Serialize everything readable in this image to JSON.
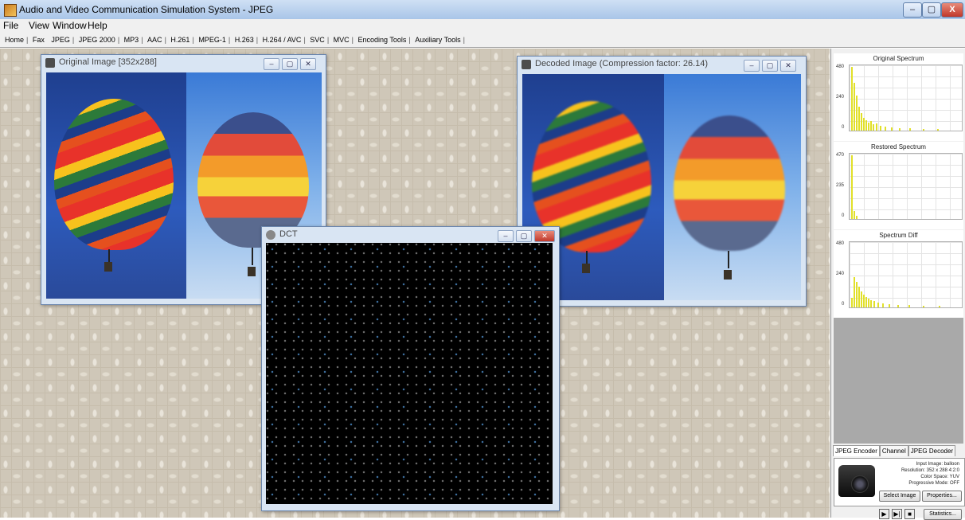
{
  "window": {
    "title": "Audio and Video Communication Simulation System - JPEG",
    "min": "–",
    "max": "▢",
    "close": "X"
  },
  "menu": {
    "file": "File",
    "view": "View",
    "window": "Window",
    "help": "Help"
  },
  "tabs": [
    "Home",
    "Fax",
    "JPEG",
    "JPEG 2000",
    "MP3",
    "AAC",
    "H.261",
    "MPEG-1",
    "H.263",
    "H.264 / AVC",
    "SVC",
    "MVC",
    "Encoding Tools",
    "Auxiliary Tools"
  ],
  "original_window": {
    "title": "Original Image [352x288]"
  },
  "decoded_window": {
    "title": "Decoded Image (Compression factor: 26.14)"
  },
  "dct_window": {
    "title": "DCT"
  },
  "spectra": {
    "original": {
      "title": "Original Spectrum",
      "ticks": [
        "480",
        "240",
        "0"
      ]
    },
    "restored": {
      "title": "Restored Spectrum",
      "ticks": [
        "470",
        "235",
        "0"
      ]
    },
    "diff": {
      "title": "Spectrum Diff",
      "ticks": [
        "480",
        "240",
        "0"
      ]
    }
  },
  "encoder_tabs": [
    "JPEG Encoder",
    "Channel",
    "JPEG Decoder"
  ],
  "encoder_info": {
    "input": "Input Image: balloon",
    "resolution": "Resolution: 352 x 288  4:2:0",
    "color": "Color Space: YUV",
    "progressive": "Progressive Mode: OFF"
  },
  "buttons": {
    "select_image": "Select Image",
    "properties": "Properties...",
    "statistics": "Statistics..."
  },
  "playback": {
    "play": "▶",
    "step": "▶|",
    "stop": "■"
  },
  "icons": [
    "app-icon",
    "image-window-icon",
    "dct-window-icon",
    "camera-icon",
    "play-icon",
    "step-icon",
    "stop-icon"
  ],
  "colors": {
    "spectrum_bar": "#e1e02a",
    "title_gradient_top": "#cfe0f4",
    "close_red": "#c0382a"
  }
}
